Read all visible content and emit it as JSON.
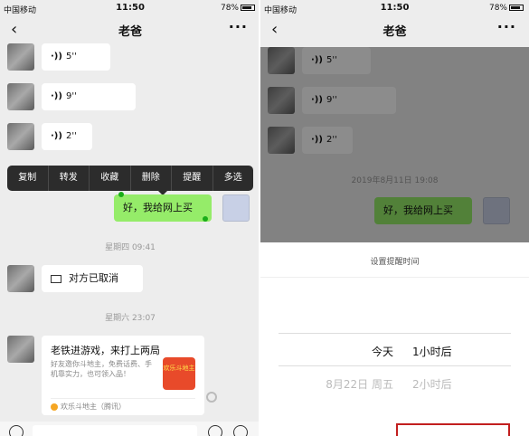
{
  "status": {
    "carrier": "中国移动",
    "time": "11:50",
    "battery": "78%"
  },
  "nav": {
    "back": "‹",
    "title": "老爸",
    "more": "···"
  },
  "left": {
    "voice": [
      "5''",
      "9''",
      "2''"
    ],
    "menu": [
      "复制",
      "转发",
      "收藏",
      "删除",
      "提醒",
      "多选"
    ],
    "my_message": "好，我给网上买",
    "ts1": "星期四 09:41",
    "call_text": "对方已取消",
    "ts2": "星期六 23:07",
    "card": {
      "title": "老铁进游戏，来打上两局",
      "desc": "好友邀你斗地主，免费话费、手机靠实力，也可领入品！",
      "thumb": "欢乐斗地主",
      "source": "欢乐斗地主（腾讯）"
    }
  },
  "right": {
    "voice": [
      "5''",
      "9''",
      "2''"
    ],
    "ts": "2019年8月11日 19:08",
    "my_message": "好，我给网上买",
    "sheet_title": "设置提醒时间",
    "picker_rows": [
      {
        "day": "今天",
        "hour": "1小时后"
      },
      {
        "day": "8月22日 周五",
        "hour": "2小时后"
      }
    ]
  },
  "colors": {
    "green_bubble": "#95ec69",
    "highlight_border": "#c21f1f"
  }
}
